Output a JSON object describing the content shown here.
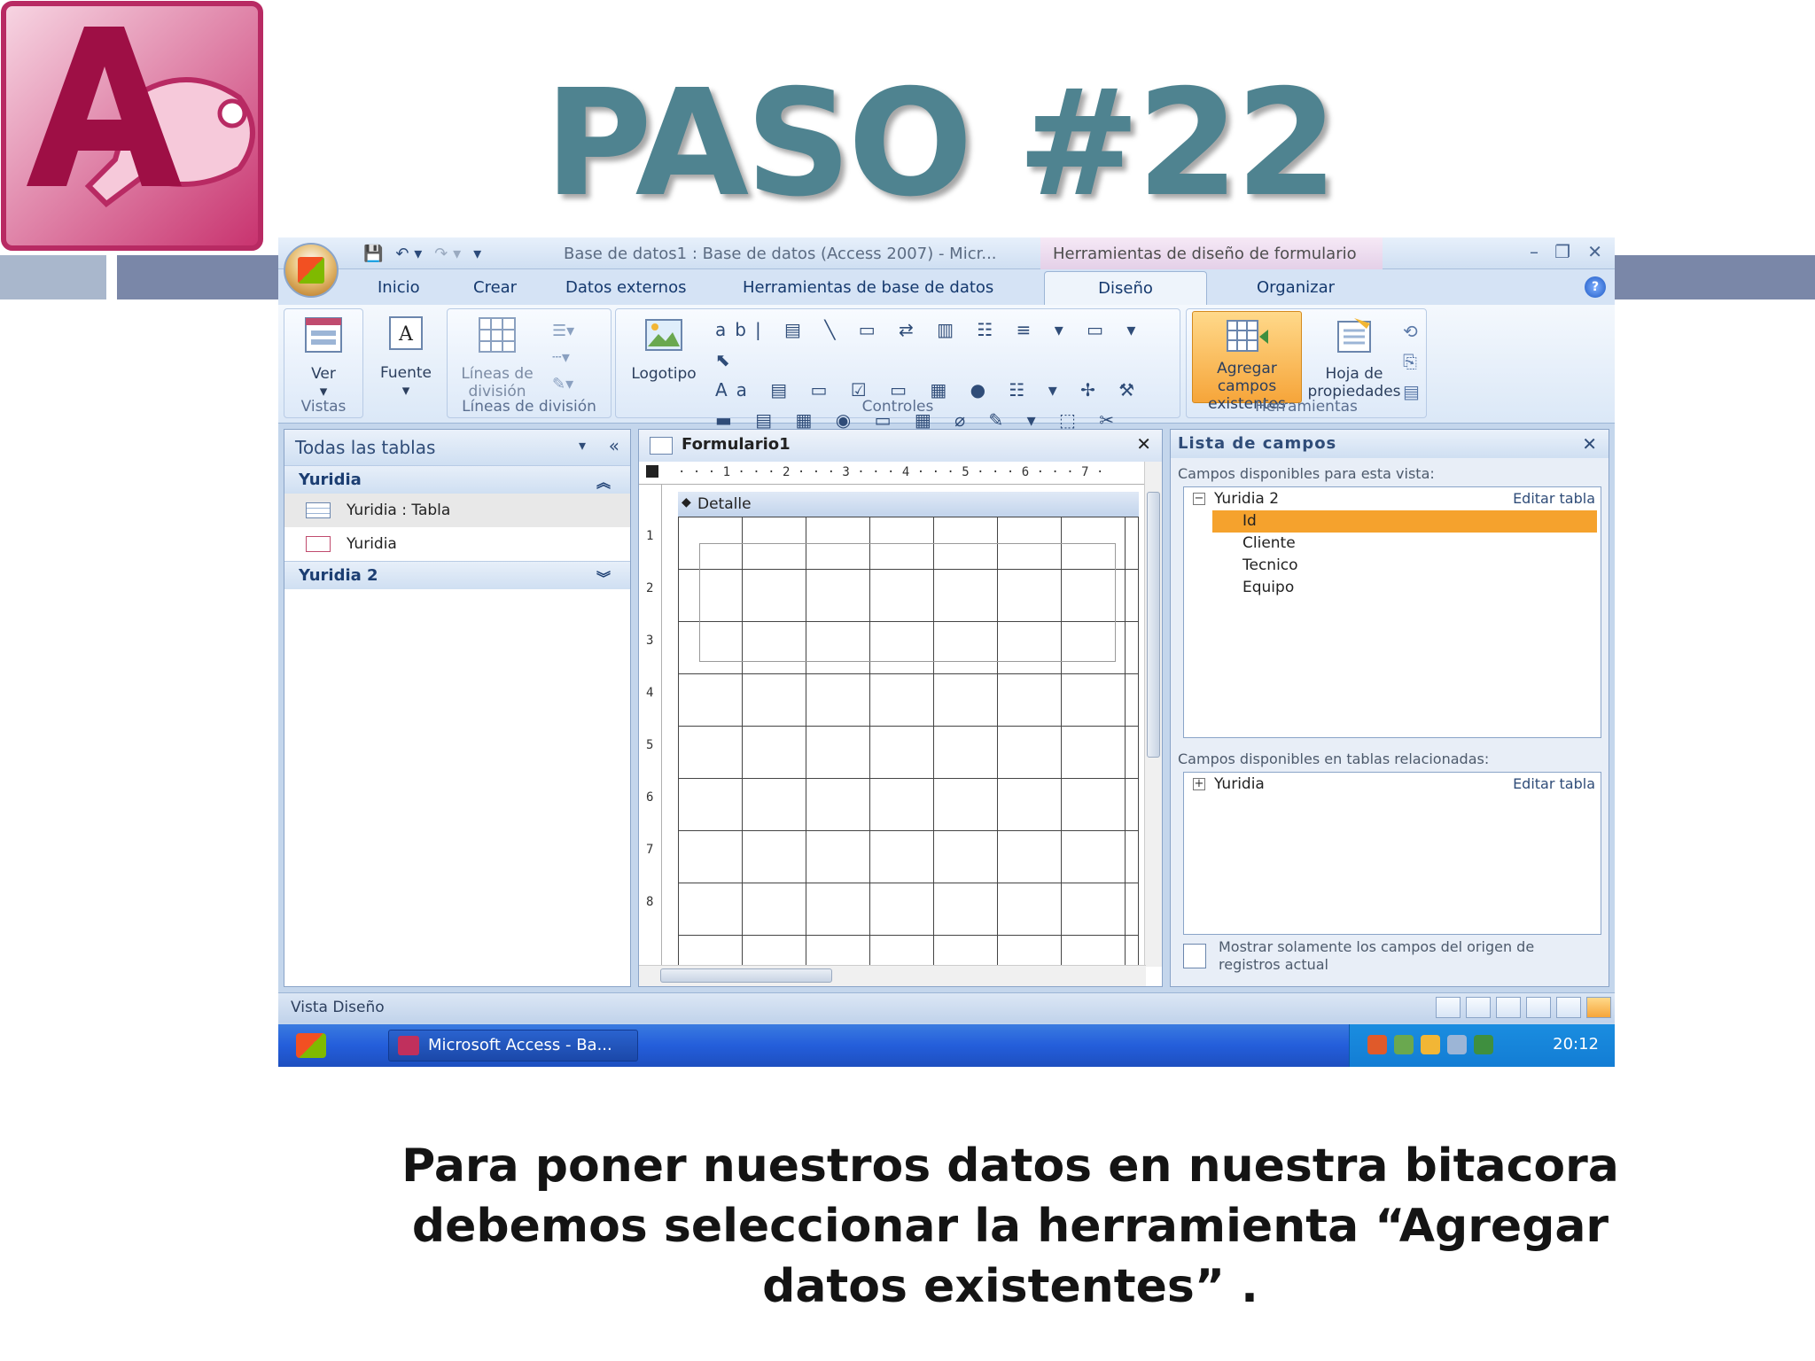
{
  "slide": {
    "title": "PASO #22",
    "caption_line1": "Para  poner nuestros datos en nuestra bitacora",
    "caption_line2": "debemos seleccionar la herramienta “Agregar",
    "caption_line3": "datos existentes” ."
  },
  "window": {
    "title": "Base de datos1 : Base de datos (Access 2007) - Micr...",
    "context_tab": "Herramientas de diseño de formulario"
  },
  "tabs": {
    "inicio": "Inicio",
    "crear": "Crear",
    "datos_externos": "Datos externos",
    "herramientas_bd": "Herramientas de base de datos",
    "diseno": "Diseño",
    "organizar": "Organizar"
  },
  "ribbon": {
    "vistas_group": "Vistas",
    "ver": "Ver",
    "fuente": "Fuente",
    "lineas_label_1": "Líneas de",
    "lineas_label_2": "división",
    "lineas_group": "Líneas de división",
    "logotipo": "Logotipo",
    "controles_group": "Controles",
    "agregar_1": "Agregar campos",
    "agregar_2": "existentes",
    "hoja_1": "Hoja de",
    "hoja_2": "propiedades",
    "herramientas_group": "Herramientas"
  },
  "nav": {
    "header": "Todas las tablas",
    "group1": "Yuridia",
    "item_table": "Yuridia : Tabla",
    "item_form": "Yuridia",
    "group2": "Yuridia 2"
  },
  "designer": {
    "tab": "Formulario1",
    "ruler": "· · · 1 · · · 2 · · · 3 · · · 4 · · · 5 · · · 6 · · · 7 ·",
    "section": "Detalle",
    "vnums": [
      "1",
      "2",
      "3",
      "4",
      "5",
      "6",
      "7",
      "8"
    ]
  },
  "fieldlist": {
    "header": "Lista de campos",
    "available_label": "Campos disponibles para esta vista:",
    "table1": "Yuridia 2",
    "edit1": "Editar tabla",
    "fields": [
      "Id",
      "Cliente",
      "Tecnico",
      "Equipo"
    ],
    "related_label": "Campos disponibles en tablas relacionadas:",
    "table2": "Yuridia",
    "edit2": "Editar tabla",
    "footer_1": "Mostrar solamente los campos del origen de",
    "footer_2": "registros actual"
  },
  "status": {
    "text": "Vista Diseño"
  },
  "taskbar": {
    "item": "Microsoft Access - Ba...",
    "clock": "20:12"
  },
  "colors": {
    "title": "#4f8390",
    "accent_bar": "#7a87a8",
    "selection": "#f5a22d"
  }
}
